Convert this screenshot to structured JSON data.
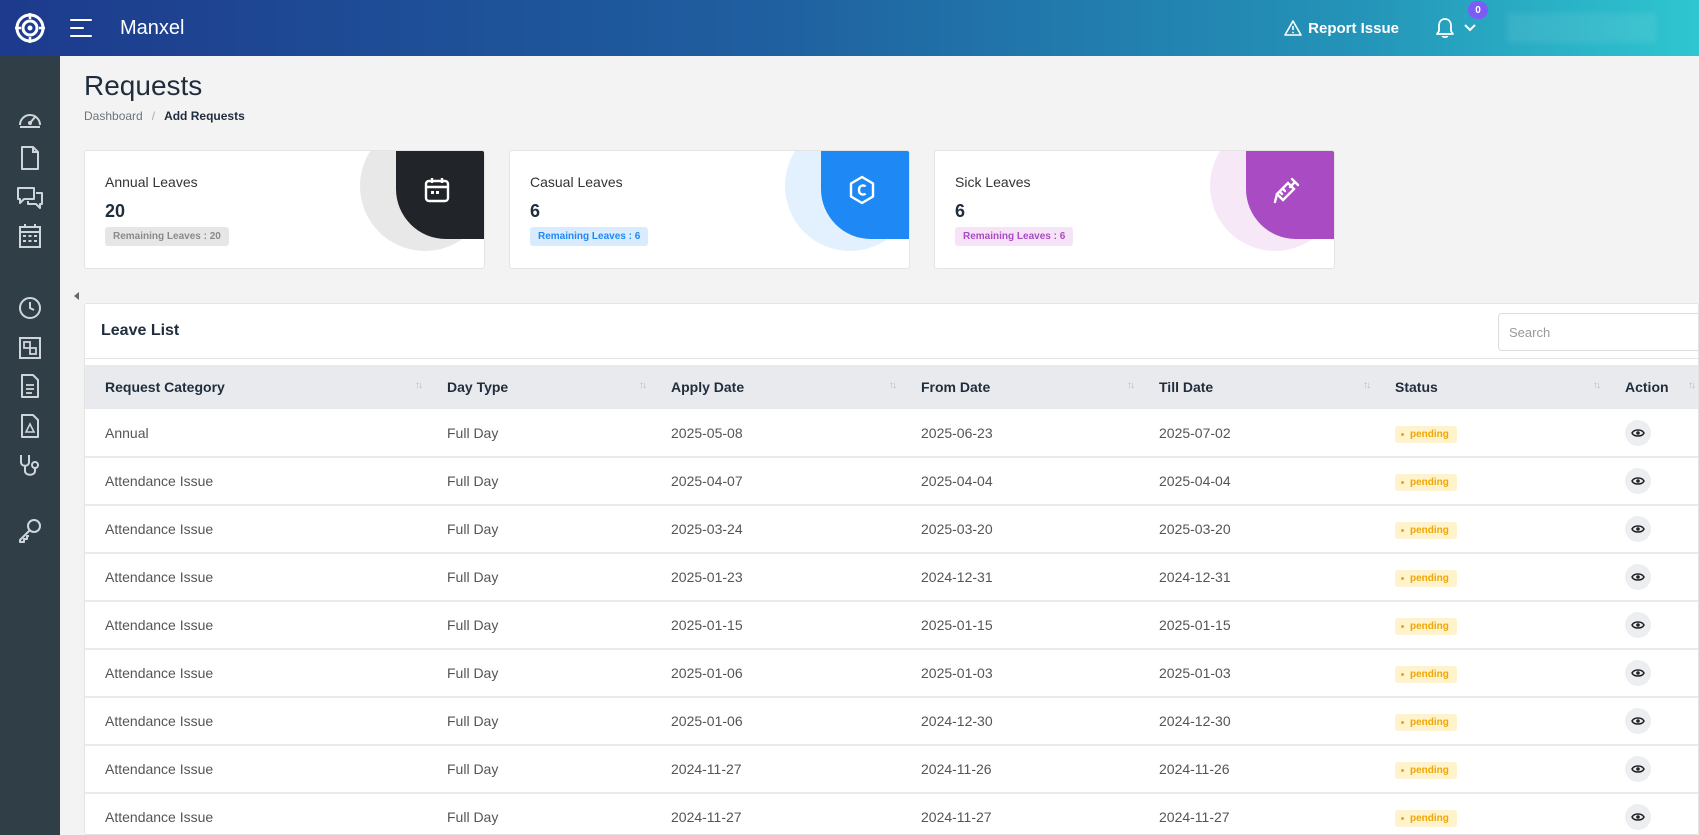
{
  "app": {
    "title": "Manxel"
  },
  "header": {
    "report_label": "Report Issue",
    "notification_count": "0"
  },
  "page": {
    "title": "Requests"
  },
  "breadcrumb": {
    "items": [
      "Dashboard",
      "Add Requests"
    ]
  },
  "cards": [
    {
      "title": "Annual Leaves",
      "value": "20",
      "remaining": "Remaining Leaves : 20",
      "accent": "#212529",
      "icon": "calendar-icon"
    },
    {
      "title": "Casual Leaves",
      "value": "6",
      "remaining": "Remaining Leaves : 6",
      "accent": "#1e88f5",
      "icon": "hexagon-c-icon"
    },
    {
      "title": "Sick Leaves",
      "value": "6",
      "remaining": "Remaining Leaves : 6",
      "accent": "#a94bc2",
      "icon": "syringe-icon"
    }
  ],
  "leave_list": {
    "title": "Leave List",
    "search_placeholder": "Search",
    "columns": [
      "Request Category",
      "Day Type",
      "Apply Date",
      "From Date",
      "Till Date",
      "Status",
      "Action"
    ],
    "rows": [
      {
        "category": "Annual",
        "day_type": "Full Day",
        "apply": "2025-05-08",
        "from": "2025-06-23",
        "till": "2025-07-02",
        "status": "pending"
      },
      {
        "category": "Attendance Issue",
        "day_type": "Full Day",
        "apply": "2025-04-07",
        "from": "2025-04-04",
        "till": "2025-04-04",
        "status": "pending"
      },
      {
        "category": "Attendance Issue",
        "day_type": "Full Day",
        "apply": "2025-03-24",
        "from": "2025-03-20",
        "till": "2025-03-20",
        "status": "pending"
      },
      {
        "category": "Attendance Issue",
        "day_type": "Full Day",
        "apply": "2025-01-23",
        "from": "2024-12-31",
        "till": "2024-12-31",
        "status": "pending"
      },
      {
        "category": "Attendance Issue",
        "day_type": "Full Day",
        "apply": "2025-01-15",
        "from": "2025-01-15",
        "till": "2025-01-15",
        "status": "pending"
      },
      {
        "category": "Attendance Issue",
        "day_type": "Full Day",
        "apply": "2025-01-06",
        "from": "2025-01-03",
        "till": "2025-01-03",
        "status": "pending"
      },
      {
        "category": "Attendance Issue",
        "day_type": "Full Day",
        "apply": "2025-01-06",
        "from": "2024-12-30",
        "till": "2024-12-30",
        "status": "pending"
      },
      {
        "category": "Attendance Issue",
        "day_type": "Full Day",
        "apply": "2024-11-27",
        "from": "2024-11-26",
        "till": "2024-11-26",
        "status": "pending"
      },
      {
        "category": "Attendance Issue",
        "day_type": "Full Day",
        "apply": "2024-11-27",
        "from": "2024-11-27",
        "till": "2024-11-27",
        "status": "pending"
      }
    ]
  },
  "sidebar": {
    "icons": [
      "speedometer-icon",
      "document-icon",
      "chat-icon",
      "calendar-icon",
      "clock-icon",
      "organization-icon",
      "file-text-icon",
      "pdf-icon",
      "stethoscope-icon",
      "key-icon"
    ]
  },
  "colors": {
    "brand_start": "#1d3a8c",
    "brand_end": "#2ec6d0",
    "sidebar": "#2f3e47",
    "pending": "#f1a600",
    "badge": "#7b5cf6"
  }
}
